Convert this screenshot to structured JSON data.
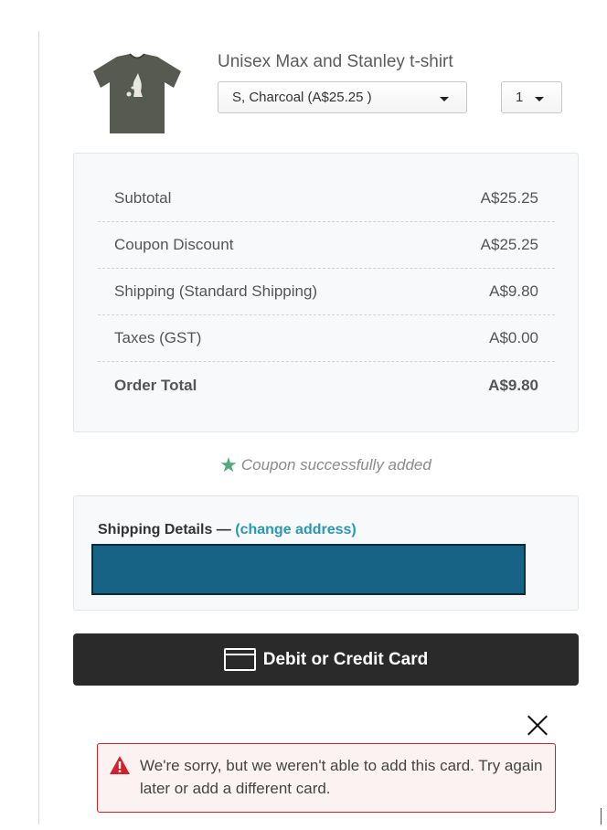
{
  "product": {
    "name": "Unisex Max and Stanley t-shirt",
    "variant_value": "S, Charcoal (A$25.25 )",
    "quantity_value": "1",
    "image_icon": "tshirt-thumbnail-icon",
    "shirt_color": "#575a50"
  },
  "summary": {
    "rows": [
      {
        "label": "Subtotal",
        "value": "A$25.25"
      },
      {
        "label": "Coupon Discount",
        "value": "A$25.25"
      },
      {
        "label": "Shipping (Standard Shipping)",
        "value": "A$9.80"
      },
      {
        "label": "Taxes (GST)",
        "value": "A$0.00"
      }
    ],
    "total": {
      "label": "Order Total",
      "value": "A$9.80"
    }
  },
  "coupon": {
    "icon": "star-icon",
    "message": "Coupon successfully added"
  },
  "shipping": {
    "heading": "Shipping Details —",
    "change_link": "(change address)"
  },
  "payment": {
    "button_label": "Debit or Credit Card",
    "icon": "credit-card-icon"
  },
  "error": {
    "icon": "warning-icon",
    "message": "We're sorry, but we weren't able to add this card. Try again later or add a different card."
  },
  "colors": {
    "accent_link": "#2b97b5",
    "success_star": "#52a87a",
    "error_red": "#d3212c",
    "button_dark": "#2a2a2a",
    "address_fill": "#176385"
  }
}
